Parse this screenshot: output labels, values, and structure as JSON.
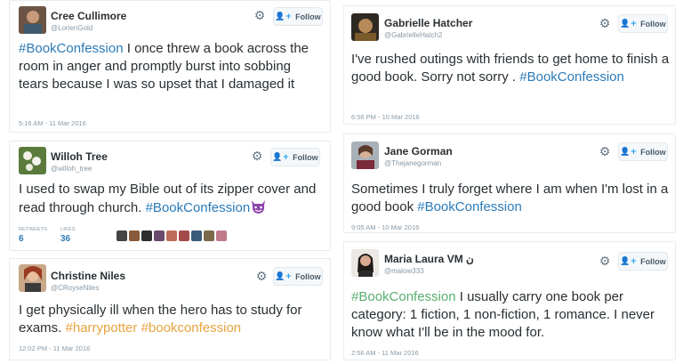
{
  "tweets": [
    {
      "name": "Cree Cullimore",
      "handle": "@LorienGold",
      "text_parts": [
        {
          "t": "#BookConfession",
          "k": "tag"
        },
        {
          "t": " I once threw a book across the room in anger and promptly burst into sobbing tears because I was so upset that I damaged it",
          "k": ""
        }
      ],
      "time": "5:16 AM - 11 Mar 2016",
      "follow_label": "Follow"
    },
    {
      "name": "Willoh Tree",
      "handle": "@willoh_tree",
      "text_parts": [
        {
          "t": "I used to swap my Bible out of its zipper cover and read through church. ",
          "k": ""
        },
        {
          "t": "#BookConfession",
          "k": "tag"
        }
      ],
      "emoji": "smiling-devil-emoji",
      "retweets_label": "RETWEETS",
      "retweets": "6",
      "likes_label": "LIKES",
      "likes": "36",
      "follow_label": "Follow"
    },
    {
      "name": "Christine Niles",
      "handle": "@CRoyseNiles",
      "text_parts": [
        {
          "t": "I get physically ill when the hero has to study for exams. ",
          "k": ""
        },
        {
          "t": "#harrypotter",
          "k": "tag-o"
        },
        {
          "t": " ",
          "k": ""
        },
        {
          "t": "#bookconfession",
          "k": "tag-o"
        }
      ],
      "time": "12:02 PM - 11 Mar 2016",
      "follow_label": "Follow"
    },
    {
      "name": "Gabrielle Hatcher",
      "handle": "@GabrielleHatch2",
      "text_parts": [
        {
          "t": "I've rushed outings with friends to get home to finish a good book. Sorry not sorry . ",
          "k": ""
        },
        {
          "t": "#BookConfession",
          "k": "tag"
        }
      ],
      "time": "6:56 PM - 10 Mar 2016",
      "follow_label": "Follow"
    },
    {
      "name": "Jane Gorman",
      "handle": "@Thejanegorman",
      "text_parts": [
        {
          "t": "Sometimes I truly forget where I am when I'm lost in a good book ",
          "k": ""
        },
        {
          "t": "#BookConfession",
          "k": "tag"
        }
      ],
      "time": "9:05 AM - 10 Mar 2016",
      "follow_label": "Follow"
    },
    {
      "name": "Maria Laura VM ن",
      "handle": "@malow333",
      "text_parts": [
        {
          "t": "#BookConfession",
          "k": "tag-g"
        },
        {
          "t": " I usually carry one book per category: 1 fiction, 1 non-fiction, 1 romance. I never know what I'll be in the mood for.",
          "k": ""
        }
      ],
      "time": "2:56 AM - 11 Mar 2016",
      "follow_label": "Follow"
    }
  ],
  "colors": {
    "hashtag_blue": "#2b7bb9",
    "hashtag_orange": "#e8a33d",
    "hashtag_green": "#59ae6e",
    "follow_icon": "#1da1f2"
  },
  "icons": {
    "gear": "gear-icon",
    "follow": "person-add-icon"
  }
}
